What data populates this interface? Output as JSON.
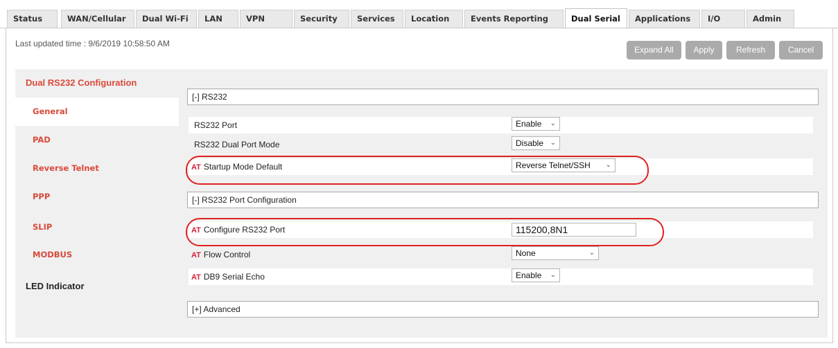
{
  "tabs": [
    {
      "label": "Status"
    },
    {
      "label": "WAN/Cellular"
    },
    {
      "label": "Dual Wi-Fi"
    },
    {
      "label": "LAN"
    },
    {
      "label": "VPN"
    },
    {
      "label": "Security"
    },
    {
      "label": "Services"
    },
    {
      "label": "Location"
    },
    {
      "label": "Events Reporting"
    },
    {
      "label": "Dual Serial",
      "active": true
    },
    {
      "label": "Applications"
    },
    {
      "label": "I/O"
    },
    {
      "label": "Admin"
    }
  ],
  "header": {
    "last_updated": "Last updated time : 9/6/2019 10:58:50 AM"
  },
  "buttons": {
    "expand_all": "Expand All",
    "apply": "Apply",
    "refresh": "Refresh",
    "cancel": "Cancel"
  },
  "sidebar": {
    "heading": "Dual RS232 Configuration",
    "items": [
      {
        "label": "General",
        "active": true
      },
      {
        "label": "PAD"
      },
      {
        "label": "Reverse Telnet"
      },
      {
        "label": "PPP"
      },
      {
        "label": "SLIP"
      },
      {
        "label": "MODBUS"
      }
    ],
    "led": "LED Indicator"
  },
  "sections": {
    "rs232": "[-] RS232",
    "port_config": "[-] RS232 Port Configuration",
    "advanced": "[+] Advanced"
  },
  "at_marker": "AT",
  "fields": {
    "rs232_port": {
      "label": "RS232 Port",
      "value": "Enable"
    },
    "dual_port_mode": {
      "label": "RS232 Dual Port Mode",
      "value": "Disable"
    },
    "startup_mode": {
      "label": "Startup Mode Default",
      "value": "Reverse Telnet/SSH"
    },
    "configure_port": {
      "label": "Configure RS232 Port",
      "value": "115200,8N1"
    },
    "flow_control": {
      "label": "Flow Control",
      "value": "None"
    },
    "db9_echo": {
      "label": "DB9 Serial Echo",
      "value": "Enable"
    }
  },
  "colors": {
    "accent_red": "#d94a3a",
    "button_gray": "#aaaaaa",
    "highlight_oval": "#e02020"
  }
}
